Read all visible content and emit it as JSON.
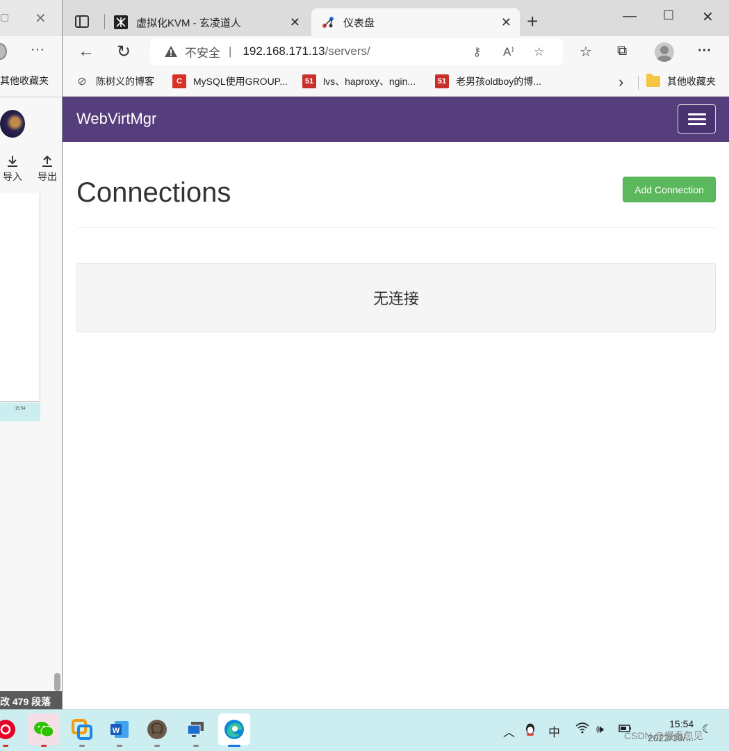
{
  "background_window": {
    "favorites_label": "其他收藏夹",
    "import_label": "导入",
    "export_label": "导出",
    "thumb_time": "15:54",
    "status_prefix": "改",
    "status_count": "479",
    "status_suffix": "段落"
  },
  "browser": {
    "tabs": [
      {
        "title": "虚拟化KVM - 玄凌道人",
        "active": false
      },
      {
        "title": "仪表盘",
        "active": true
      }
    ],
    "address": {
      "security_label": "不安全",
      "separator": "|",
      "host": "192.168.171.13",
      "path": "/servers/"
    },
    "bookmarks": [
      {
        "label": "陈树义的博客",
        "icon": "globe-icon"
      },
      {
        "label": "MySQL使用GROUP...",
        "icon": "c-icon",
        "icon_text": "C",
        "icon_color": "#d93025"
      },
      {
        "label": "lvs、haproxy、ngin...",
        "icon": "51cto-icon",
        "icon_text": "51",
        "icon_color": "#c9302c"
      },
      {
        "label": "老男孩oldboy的博...",
        "icon": "51cto-icon",
        "icon_text": "51",
        "icon_color": "#c9302c"
      }
    ],
    "other_favorites": "其他收藏夹"
  },
  "app": {
    "brand": "WebVirtMgr",
    "brand_color": "#563d7c",
    "page_title": "Connections",
    "add_button": "Add Connection",
    "add_button_color": "#5cb85c",
    "empty_message": "无连接"
  },
  "taskbar": {
    "apps": [
      "netease-music-icon",
      "wechat-icon",
      "app-icon",
      "word-icon",
      "avatar-app-icon",
      "remote-desktop-icon",
      "edge-icon"
    ],
    "ime": "中",
    "time": "15:54",
    "date": "2022/10/..."
  },
  "watermark": "CSDN @慢春忽见"
}
